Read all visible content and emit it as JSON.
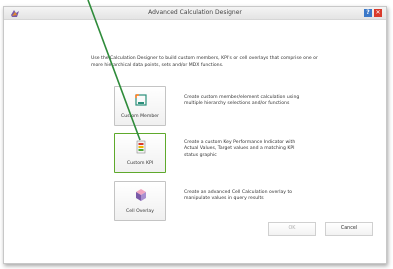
{
  "window": {
    "title": "Advanced Calculation Designer",
    "help_label": "?",
    "close_label": "✕",
    "app_icon": "designer-logo-icon"
  },
  "intro": {
    "text": "Use the Calculation Designer to build custom members, KPI's or cell overlays that comprise one or more hierarchical data points, sets and/or MDX functions."
  },
  "options": [
    {
      "label": "Custom Member",
      "icon": "custom-member-icon",
      "description": "Create custom member/element calculation using multiple hierarchy selections and/or functions"
    },
    {
      "label": "Custom KPI",
      "icon": "custom-kpi-icon",
      "description": "Create a custom Key Performance Indicator with Actual Values, Target values and a matching KPI status graphic",
      "selected": true
    },
    {
      "label": "Cell Overlay",
      "icon": "cell-overlay-icon",
      "description": "Create an advanced Cell Calculation overlay to manipulate values in query results"
    }
  ],
  "footer": {
    "ok_label": "OK",
    "cancel_label": "Cancel"
  },
  "colors": {
    "highlight": "#5fa92c",
    "title_text": "#444444",
    "help": "#3b78c8",
    "close": "#d93a2b"
  }
}
